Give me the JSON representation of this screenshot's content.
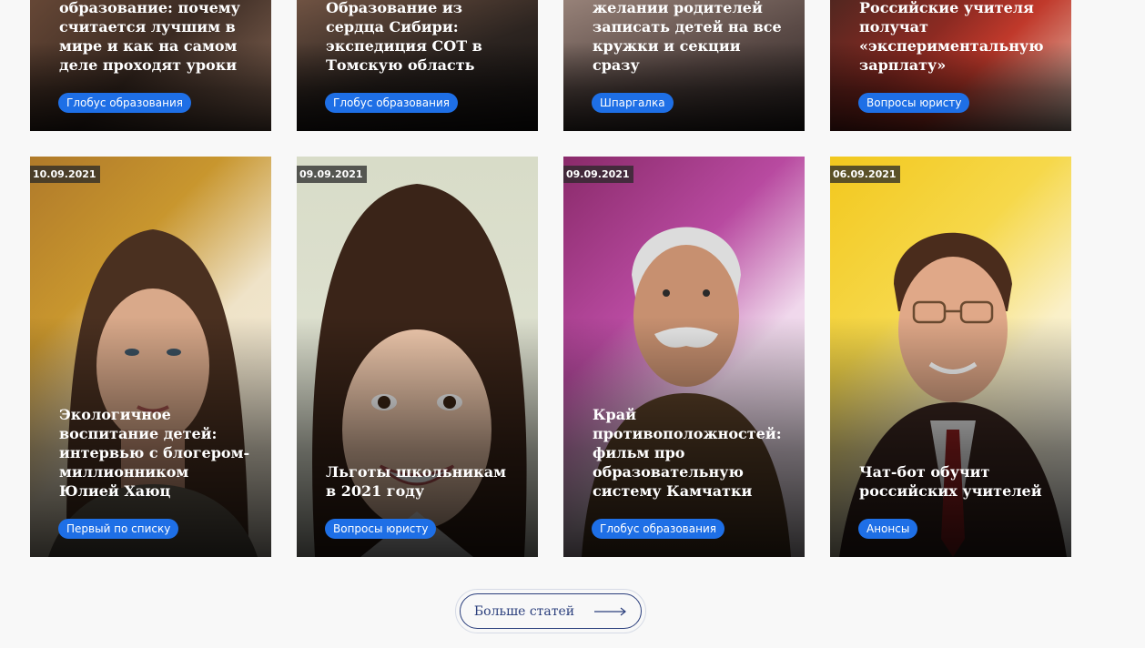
{
  "top_cards": [
    {
      "title": "образование: почему считается лучшим в мире и как на самом деле проходят уроки",
      "tag": "Глобус образования"
    },
    {
      "title": "Образование из сердца Сибири: экспедиция СОТ в Томскую область",
      "tag": "Глобус образования"
    },
    {
      "title": "думают психологи о желании родителей записать детей на все кружки и секции сразу",
      "tag": "Шпаргалка"
    },
    {
      "title": "Российские учителя получат «экспериментальную зарплату»",
      "tag": "Вопросы юристу"
    }
  ],
  "bottom_cards": [
    {
      "date": "10.09.2021",
      "title": "Экологичное воспитание детей: интервью с блогером-миллионником Юлией Хаюц",
      "tag": "Первый по списку"
    },
    {
      "date": "09.09.2021",
      "title": "Льготы школьникам в 2021 году",
      "tag": "Вопросы юристу"
    },
    {
      "date": "09.09.2021",
      "title": "Край противоположностей: фильм про образовательную систему Камчатки",
      "tag": "Глобус образования"
    },
    {
      "date": "06.09.2021",
      "title": "Чат-бот обучит российских учителей",
      "tag": "Анонсы"
    }
  ],
  "more_button": {
    "label": "Больше статей",
    "icon": "arrow-right-icon"
  },
  "colors": {
    "tag_bg": "#1e6fe6",
    "button_border": "#2a3e7c",
    "page_bg": "#f8f8f8"
  }
}
